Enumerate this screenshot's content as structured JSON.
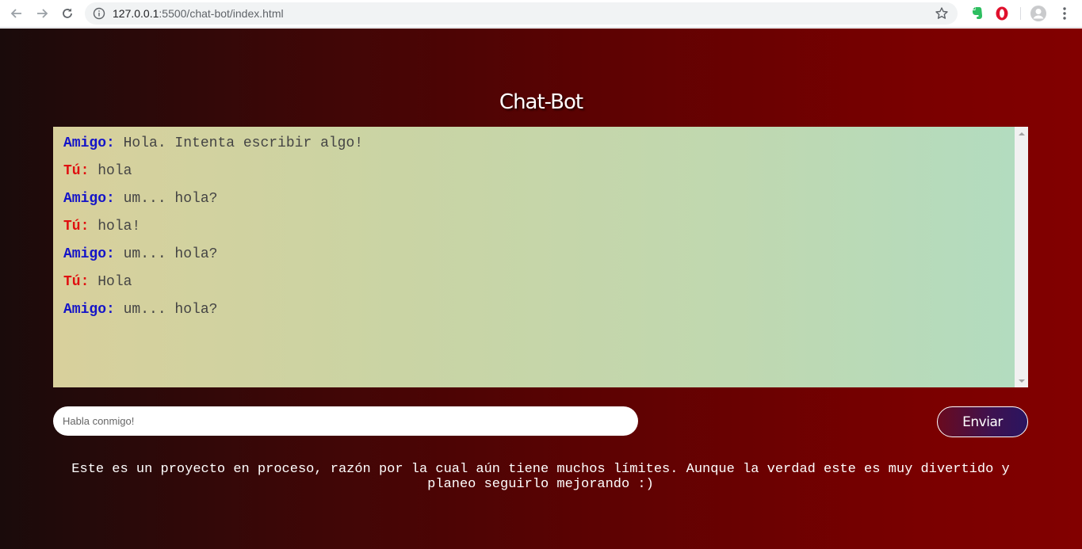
{
  "browser": {
    "url_host": "127.0.0.1",
    "url_path": ":5500/chat-bot/index.html",
    "icons": [
      "back-arrow-icon",
      "forward-arrow-icon",
      "reload-icon",
      "info-icon",
      "star-icon",
      "evernote-icon",
      "opera-icon",
      "avatar-icon",
      "kebab-menu-icon"
    ]
  },
  "page": {
    "title": "Chat-Bot",
    "messages": [
      {
        "sender": "Amigo:",
        "role": "bot",
        "text": "Hola. Intenta escribir algo!"
      },
      {
        "sender": "Tú:",
        "role": "user",
        "text": "hola"
      },
      {
        "sender": "Amigo:",
        "role": "bot",
        "text": "um... hola?"
      },
      {
        "sender": "Tú:",
        "role": "user",
        "text": "hola!"
      },
      {
        "sender": "Amigo:",
        "role": "bot",
        "text": "um... hola?"
      },
      {
        "sender": "Tú:",
        "role": "user",
        "text": "Hola"
      },
      {
        "sender": "Amigo:",
        "role": "bot",
        "text": "um... hola?"
      }
    ],
    "input_placeholder": "Habla conmigo!",
    "input_value": "",
    "send_label": "Enviar",
    "footer_note": "Este es un proyecto en proceso, razón por la cual aún tiene muchos límites. Aunque la verdad este es muy divertido y planeo seguirlo mejorando :)"
  },
  "colors": {
    "bot_sender": "#1414c8",
    "user_sender": "#e01010",
    "message_text": "#444444",
    "background_start": "#1a0b0b",
    "background_end": "#820000"
  }
}
